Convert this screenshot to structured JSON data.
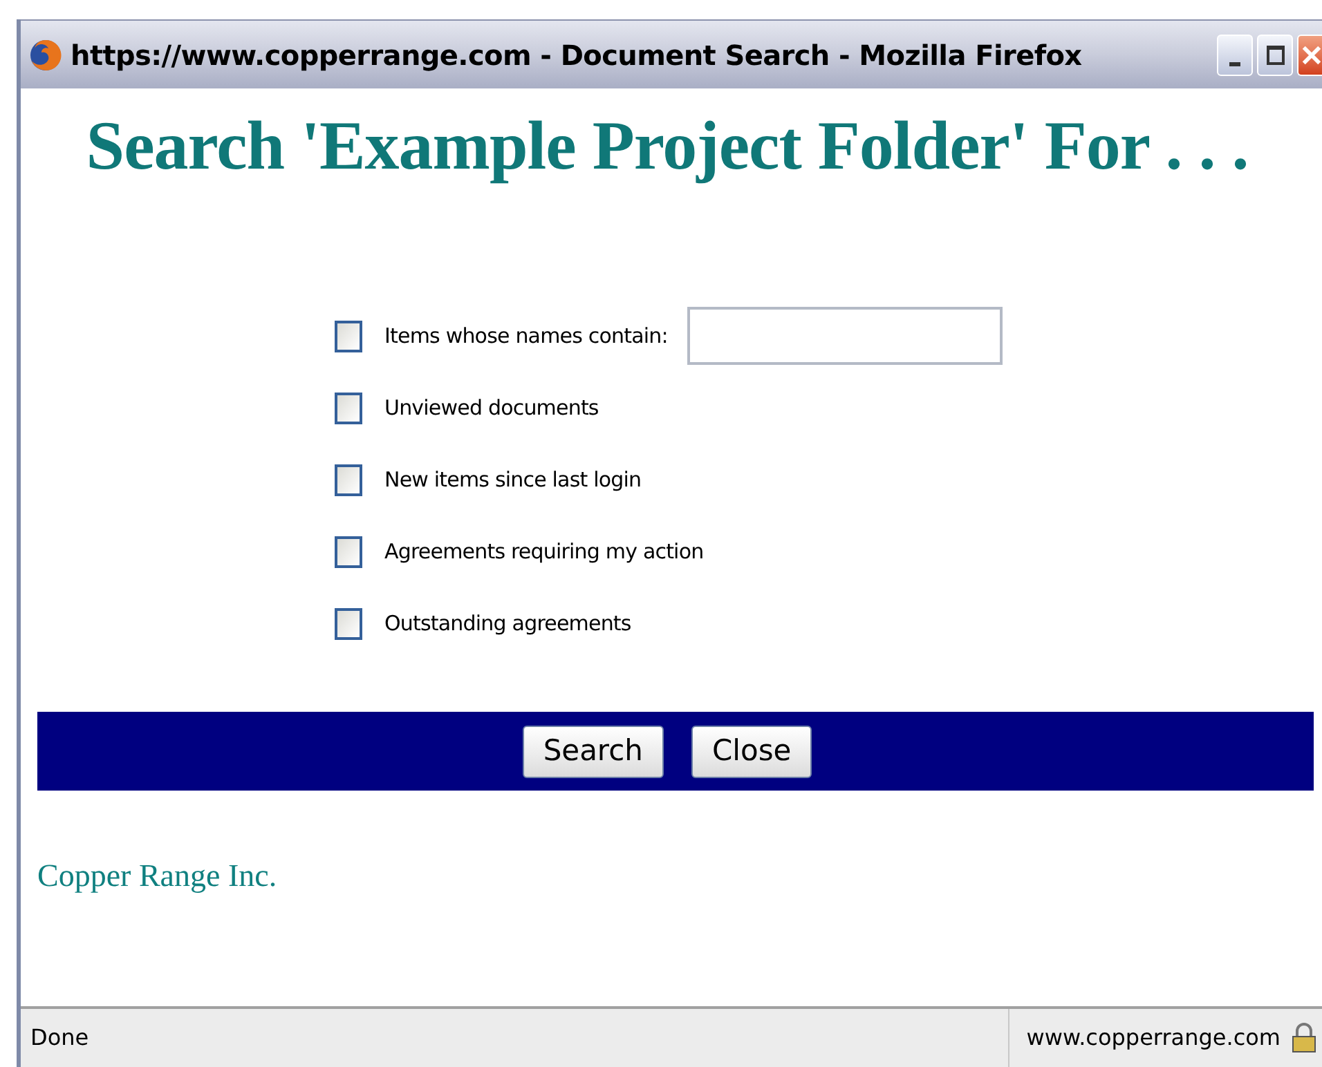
{
  "window": {
    "title": "https://www.copperrange.com - Document Search - Mozilla Firefox"
  },
  "heading": "Search 'Example Project Folder' For . . .",
  "options": [
    {
      "label": "Items whose names contain:",
      "checked": false,
      "kind": "text"
    },
    {
      "label": "Unviewed documents",
      "checked": false,
      "kind": "plain"
    },
    {
      "label": "New items since last login",
      "checked": false,
      "kind": "plain"
    },
    {
      "label": "Agreements requiring my action",
      "checked": false,
      "kind": "plain"
    },
    {
      "label": "Outstanding agreements",
      "checked": false,
      "kind": "plain"
    }
  ],
  "buttons": [
    "Search",
    "Close"
  ],
  "footer": "Copper Range Inc.",
  "status_bar": {
    "status": "Done",
    "domain": "www.copperrange.com"
  }
}
